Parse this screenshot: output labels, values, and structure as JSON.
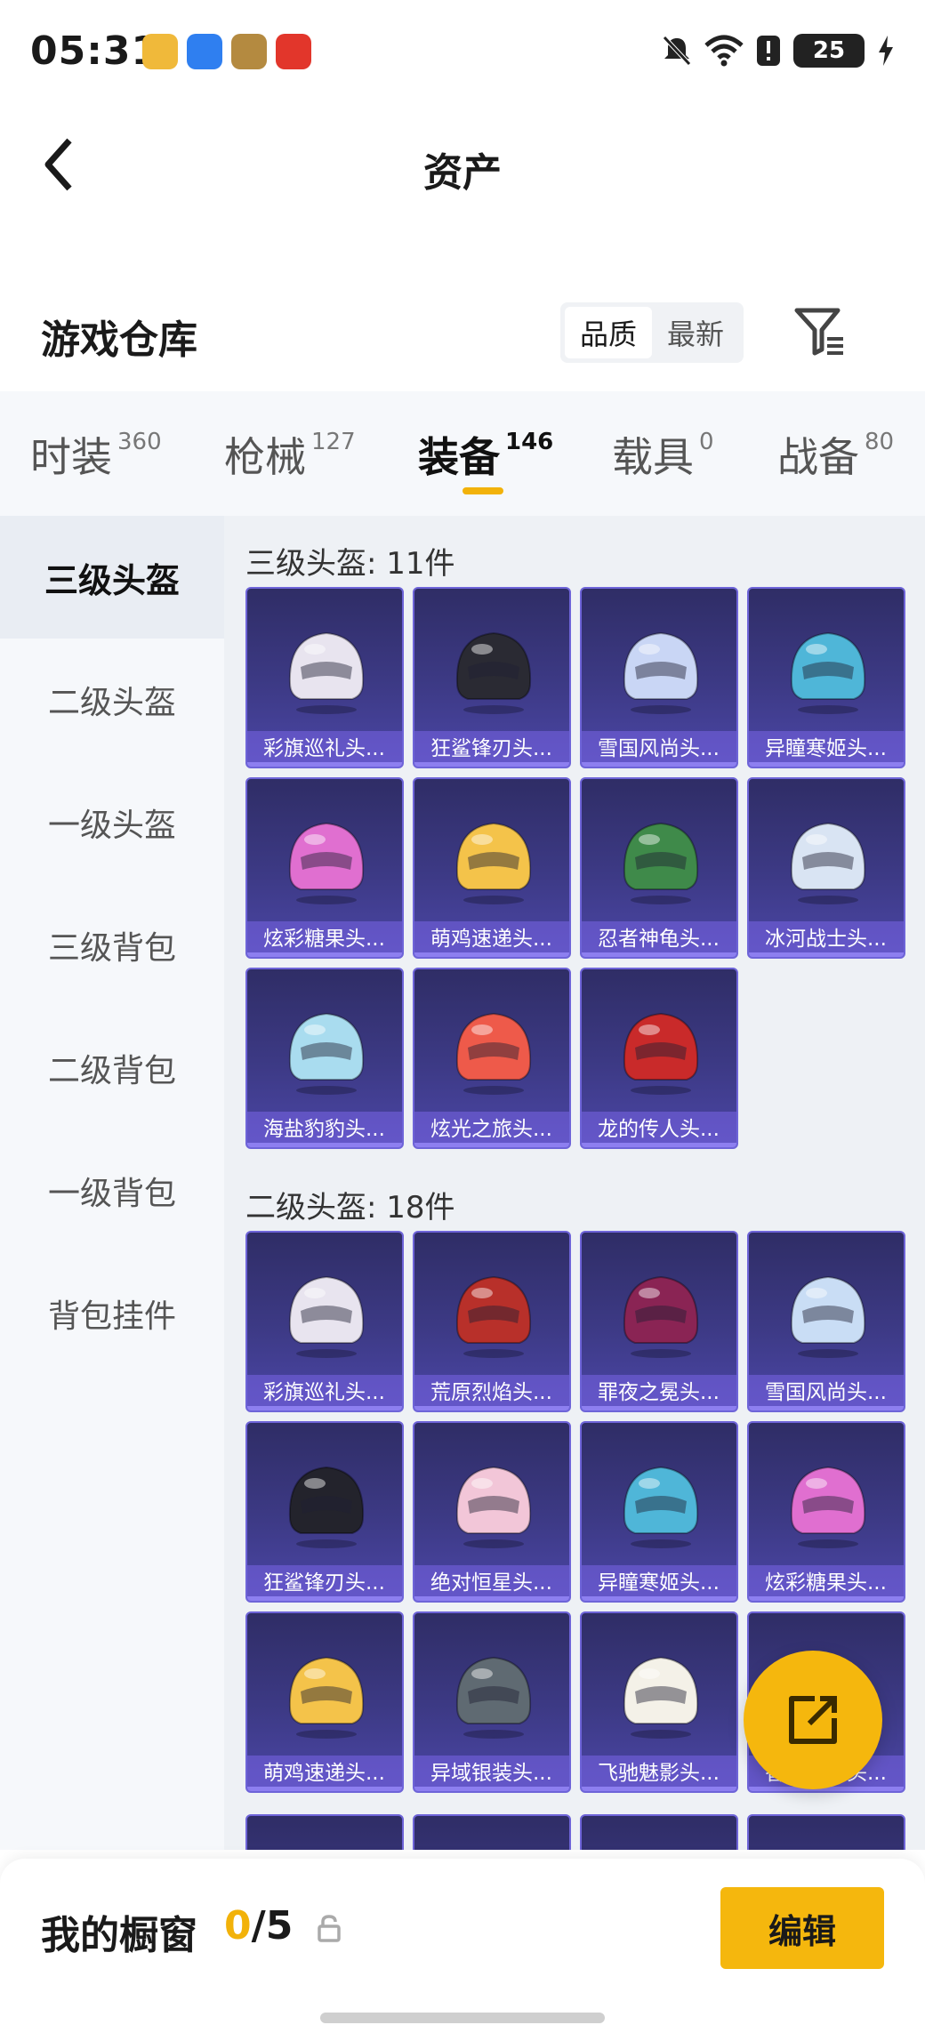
{
  "status_bar": {
    "time": "05:31",
    "battery": "25",
    "app_icon_colors": [
      "#f0b93a",
      "#2f7ff0",
      "#b48a40",
      "#e2362b"
    ],
    "icons": [
      "mute-icon",
      "wifi-icon",
      "alert-icon",
      "battery-icon",
      "charging-icon"
    ]
  },
  "header": {
    "title": "资产",
    "back_icon": "chevron-left-icon"
  },
  "warehouse": {
    "title": "游戏仓库",
    "sort_options": [
      "品质",
      "最新"
    ],
    "active_sort": "品质",
    "filter_icon": "filter-icon"
  },
  "tabs": [
    {
      "label": "时装",
      "count": "360"
    },
    {
      "label": "枪械",
      "count": "127"
    },
    {
      "label": "装备",
      "count": "146"
    },
    {
      "label": "载具",
      "count": "0"
    },
    {
      "label": "战备",
      "count": "80"
    }
  ],
  "active_tab": "装备",
  "sidebar": [
    {
      "label": "三级头盔"
    },
    {
      "label": "二级头盔"
    },
    {
      "label": "一级头盔"
    },
    {
      "label": "三级背包"
    },
    {
      "label": "二级背包"
    },
    {
      "label": "一级背包"
    },
    {
      "label": "背包挂件"
    }
  ],
  "active_sidebar": "三级头盔",
  "sections": [
    {
      "title": "三级头盔: 11件",
      "items": [
        {
          "name": "彩旗巡礼头...",
          "color": "#e8e4ef"
        },
        {
          "name": "狂鲨锋刃头...",
          "color": "#2a2a33"
        },
        {
          "name": "雪国风尚头...",
          "color": "#c9d6f5"
        },
        {
          "name": "异瞳寒姬头...",
          "color": "#4fb6d8"
        },
        {
          "name": "炫彩糖果头...",
          "color": "#e06fd0"
        },
        {
          "name": "萌鸡速递头...",
          "color": "#f4c34a"
        },
        {
          "name": "忍者神龟头...",
          "color": "#3f8a4a"
        },
        {
          "name": "冰河战士头...",
          "color": "#d9e4f3"
        },
        {
          "name": "海盐豹豹头...",
          "color": "#a9dcef"
        },
        {
          "name": "炫光之旅头...",
          "color": "#ee5a4a"
        },
        {
          "name": "龙的传人头...",
          "color": "#c92a2a"
        }
      ]
    },
    {
      "title": "二级头盔: 18件",
      "items": [
        {
          "name": "彩旗巡礼头...",
          "color": "#e8e4ef"
        },
        {
          "name": "荒原烈焰头...",
          "color": "#b8302a"
        },
        {
          "name": "罪夜之冕头...",
          "color": "#8a2454"
        },
        {
          "name": "雪国风尚头...",
          "color": "#c9ddf5"
        },
        {
          "name": "狂鲨锋刃头...",
          "color": "#23232c"
        },
        {
          "name": "绝对恒星头...",
          "color": "#f2c6d8"
        },
        {
          "name": "异瞳寒姬头...",
          "color": "#4fb6d8"
        },
        {
          "name": "炫彩糖果头...",
          "color": "#e06fd0"
        },
        {
          "name": "萌鸡速递头...",
          "color": "#f4c34a"
        },
        {
          "name": "异域银装头...",
          "color": "#5f6a72"
        },
        {
          "name": "飞驰魅影头...",
          "color": "#f4f1e8"
        },
        {
          "name": "香槟金马头...",
          "color": "#eadbb0"
        }
      ]
    }
  ],
  "showcase": {
    "label": "我的橱窗",
    "current": "0",
    "total": "/5",
    "lock_icon": "lock-icon",
    "edit_label": "编辑"
  },
  "fab_icon": "share-out-icon",
  "colors": {
    "accent": "#f5b70d",
    "card_border": "#6e64d8"
  }
}
